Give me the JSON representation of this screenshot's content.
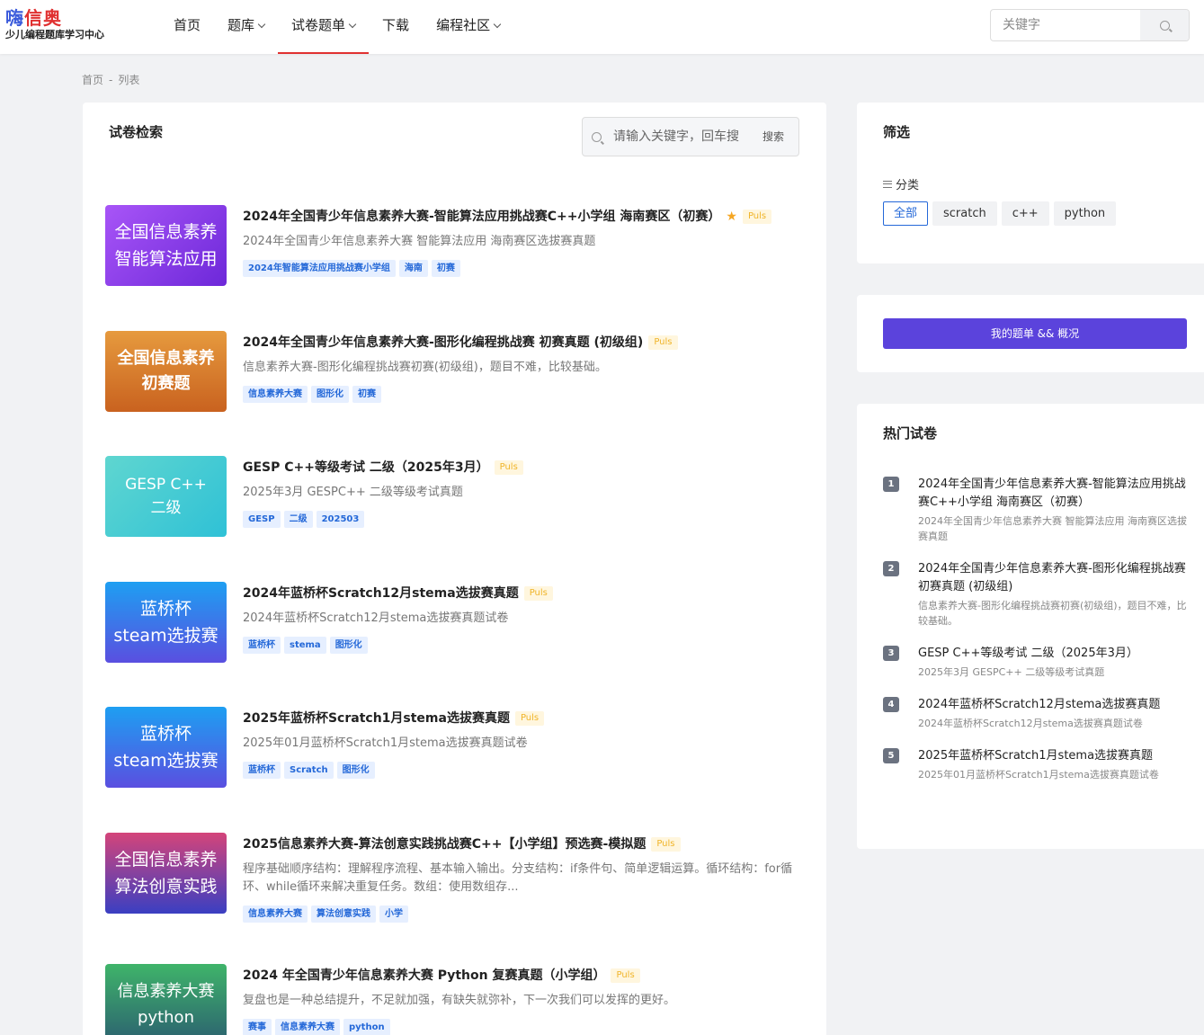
{
  "logo": {
    "brand_a": "嗨",
    "brand_b": "信奥",
    "sub": "少儿编程题库学习中心"
  },
  "nav": {
    "items": [
      {
        "label": "首页",
        "has_menu": false,
        "active": false
      },
      {
        "label": "题库",
        "has_menu": true,
        "active": false
      },
      {
        "label": "试卷题单",
        "has_menu": true,
        "active": true
      },
      {
        "label": "下载",
        "has_menu": false,
        "active": false
      },
      {
        "label": "编程社区",
        "has_menu": true,
        "active": false
      }
    ]
  },
  "top_search": {
    "placeholder": "关键字"
  },
  "breadcrumb": {
    "home": "首页",
    "sep": "-",
    "current": "列表"
  },
  "main": {
    "title": "试卷检索",
    "search": {
      "placeholder": "请输入关键字，回车搜索",
      "button": "搜索"
    },
    "items": [
      {
        "thumb": [
          "全国信息素养",
          "智能算法应用"
        ],
        "title": "2024年全国青少年信息素养大赛-智能算法应用挑战赛C++小学组 海南赛区（初赛）",
        "star": "★",
        "puls": "Puls",
        "desc": "2024年全国青少年信息素养大赛 智能算法应用 海南赛区选拔赛真题",
        "tags": [
          "2024年智能算法应用挑战赛小学组",
          "海南",
          "初赛"
        ]
      },
      {
        "thumb": [
          "全国信息素养",
          "初赛题"
        ],
        "title": "2024年全国青少年信息素养大赛-图形化编程挑战赛 初赛真题 (初级组)",
        "puls": "Puls",
        "desc": "信息素养大赛-图形化编程挑战赛初赛(初级组)，题目不难，比较基础。",
        "tags": [
          "信息素养大赛",
          "图形化",
          "初赛"
        ]
      },
      {
        "thumb": [
          "GESP C++",
          "二级"
        ],
        "title": "GESP C++等级考试 二级（2025年3月）",
        "puls": "Puls",
        "desc": "2025年3月 GESPC++ 二级等级考试真题",
        "tags": [
          "GESP",
          "二级",
          "202503"
        ]
      },
      {
        "thumb": [
          "蓝桥杯",
          "steam选拔赛"
        ],
        "title": "2024年蓝桥杯Scratch12月stema选拔赛真题",
        "puls": "Puls",
        "desc": "2024年蓝桥杯Scratch12月stema选拔赛真题试卷",
        "tags": [
          "蓝桥杯",
          "stema",
          "图形化"
        ]
      },
      {
        "thumb": [
          "蓝桥杯",
          "steam选拔赛"
        ],
        "title": "2025年蓝桥杯Scratch1月stema选拔赛真题",
        "puls": "Puls",
        "desc": "2025年01月蓝桥杯Scratch1月stema选拔赛真题试卷",
        "tags": [
          "蓝桥杯",
          "Scratch",
          "图形化"
        ]
      },
      {
        "thumb": [
          "全国信息素养",
          "算法创意实践"
        ],
        "title": "2025信息素养大赛-算法创意实践挑战赛C++【小学组】预选赛-模拟题",
        "puls": "Puls",
        "desc": "程序基础顺序结构：理解程序流程、基本输入输出。分支结构：if条件句、简单逻辑运算。循环结构：for循环、while循环来解决重复任务。数组：使用数组存...",
        "tags": [
          "信息素养大赛",
          "算法创意实践",
          "小学"
        ]
      },
      {
        "thumb": [
          "信息素养大赛",
          "python"
        ],
        "title": "2024 年全国青少年信息素养大赛 Python 复赛真题（小学组）",
        "puls": "Puls",
        "desc": "复盘也是一种总结提升，不足就加强，有缺失就弥补，下一次我们可以发挥的更好。",
        "tags": [
          "赛事",
          "信息素养大赛",
          "python"
        ]
      }
    ]
  },
  "filter": {
    "title": "筛选",
    "category_label": "分类",
    "options": [
      {
        "label": "全部",
        "active": true
      },
      {
        "label": "scratch",
        "active": false
      },
      {
        "label": "c++",
        "active": false
      },
      {
        "label": "python",
        "active": false
      }
    ]
  },
  "mine": {
    "button": "我的题单 && 概况"
  },
  "hot": {
    "title": "热门试卷",
    "items": [
      {
        "num": "1",
        "title": "2024年全国青少年信息素养大赛-智能算法应用挑战赛C++小学组 海南赛区（初赛）",
        "desc": "2024年全国青少年信息素养大赛 智能算法应用 海南赛区选拔赛真题"
      },
      {
        "num": "2",
        "title": "2024年全国青少年信息素养大赛-图形化编程挑战赛 初赛真题 (初级组)",
        "desc": "信息素养大赛-图形化编程挑战赛初赛(初级组)，题目不难，比较基础。"
      },
      {
        "num": "3",
        "title": "GESP C++等级考试 二级（2025年3月）",
        "desc": "2025年3月 GESPC++ 二级等级考试真题"
      },
      {
        "num": "4",
        "title": "2024年蓝桥杯Scratch12月stema选拔赛真题",
        "desc": "2024年蓝桥杯Scratch12月stema选拔赛真题试卷"
      },
      {
        "num": "5",
        "title": "2025年蓝桥杯Scratch1月stema选拔赛真题",
        "desc": "2025年01月蓝桥杯Scratch1月stema选拔赛真题试卷"
      }
    ]
  }
}
